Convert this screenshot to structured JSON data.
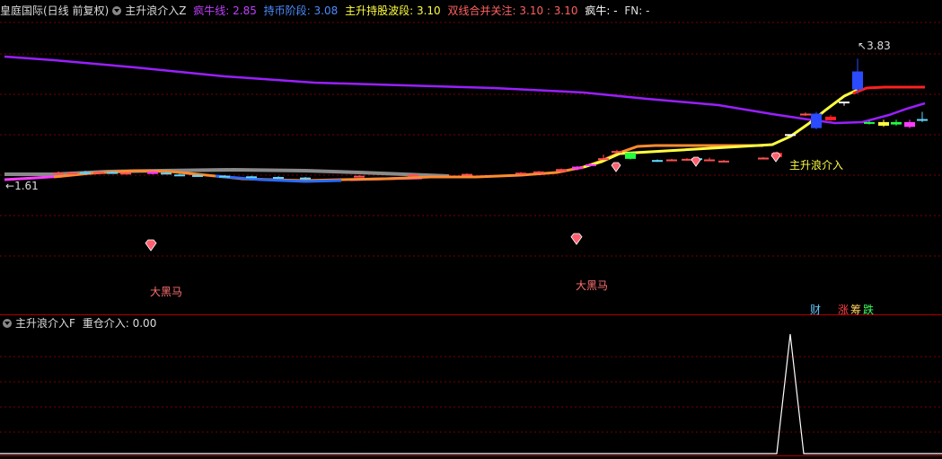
{
  "header_top": {
    "title": "皇庭国际(日线 前复权)",
    "indicator": "主升浪介入Z",
    "items": [
      {
        "label": "疯牛线",
        "value": "2.85",
        "color": "#c040ff"
      },
      {
        "label": "持币阶段",
        "value": "3.08",
        "color": "#4d8bff"
      },
      {
        "label": "主升持股波段",
        "value": "3.10",
        "color": "#ffff40"
      },
      {
        "label": "双线合并关注",
        "value": "3.10",
        "extra": "3.10",
        "color": "#ff6060"
      },
      {
        "label": "疯牛",
        "value": "-",
        "color": "#ffffff"
      },
      {
        "label": "FN",
        "value": "-",
        "color": "#dddddd"
      }
    ]
  },
  "header_bottom": {
    "indicator": "主升浪介入F",
    "item_label": "重仓介入",
    "item_value": "0.00"
  },
  "annotations": {
    "high": "3.83",
    "low": "1.61",
    "signal_label": "主升浪介入",
    "horse_1": "大黑马",
    "horse_2": "大黑马",
    "tag_cai": "财",
    "tag_zhang": "涨",
    "tag_chou": "筹",
    "tag_die": "跌"
  },
  "colors": {
    "purple": "#9a1fff",
    "red_grid": "#7a0000",
    "yellow": "#ffff40",
    "red_line": "#ff2020",
    "blue": "#2a6bff",
    "orange": "#ff8c30",
    "magenta": "#ff3bff",
    "gray": "#8a8a8a"
  },
  "chart_data": {
    "type": "line",
    "title": "皇庭国际(日线 前复权)",
    "n_bars": 170,
    "series": [
      {
        "name": "疯牛线",
        "last": 2.85
      },
      {
        "name": "持币阶段",
        "last": 3.08
      },
      {
        "name": "主升持股波段",
        "last": 3.1
      },
      {
        "name": "双线合并关注",
        "last": 3.1
      }
    ],
    "price_high": 3.83,
    "price_low": 1.61,
    "lower_panel": {
      "indicator": "主升浪介入F",
      "series": [
        {
          "name": "重仓介入",
          "last": 0.0
        }
      ],
      "spike_at_bar": 146
    }
  }
}
